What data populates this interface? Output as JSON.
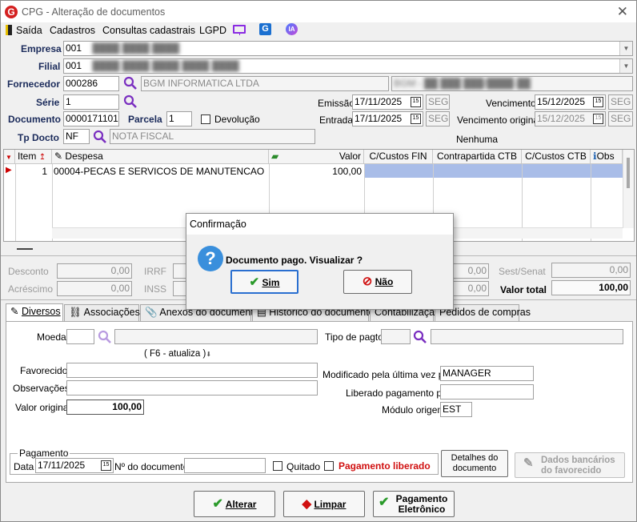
{
  "window": {
    "title": "CPG - Alteração de documentos"
  },
  "menu": {
    "items": [
      "Saída",
      "Cadastros",
      "Consultas cadastrais",
      "LGPD"
    ],
    "ia_label": "IA"
  },
  "header": {
    "empresa_label": "Empresa",
    "empresa_code": "001",
    "empresa_name": "████ ████ ████",
    "filial_label": "Filial",
    "filial_code": "001",
    "filial_name": "████ ████ ████ ████ ████",
    "fornecedor_label": "Fornecedor",
    "fornecedor_code": "000286",
    "fornecedor_name": "BGM INFORMATICA LTDA",
    "fornecedor_doc": "BGM - ██ ███ ███/████-██",
    "serie_label": "Série",
    "serie_value": "1",
    "documento_label": "Documento",
    "documento_value": "0000171101",
    "parcela_label": "Parcela",
    "parcela_value": "1",
    "devolucao_label": "Devolução",
    "tpdocto_label": "Tp Docto",
    "tpdocto_value": "NF",
    "tpdocto_desc": "NOTA FISCAL",
    "emissao_label": "Emissão",
    "emissao_value": "17/11/2025",
    "emissao_day": "SEG",
    "entrada_label": "Entrada",
    "entrada_value": "17/11/2025",
    "entrada_day": "SEG",
    "vencimento_label": "Vencimento",
    "vencimento_value": "15/12/2025",
    "vencimento_day": "SEG",
    "venc_original_label": "Vencimento original",
    "venc_original_value": "15/12/2025",
    "venc_original_day": "SEG",
    "nenhuma_label": "Nenhuma"
  },
  "grid": {
    "columns": [
      "Item",
      "Despesa",
      "Valor",
      "C/Custos FIN",
      "Contrapartida CTB",
      "C/Custos CTB",
      "Obs"
    ],
    "rows": [
      {
        "item": "1",
        "despesa": "00004-PECAS E SERVICOS DE MANUTENCAO",
        "valor": "100,00"
      }
    ]
  },
  "totals": {
    "desconto_label": "Desconto",
    "desconto_value": "0,00",
    "acrescimo_label": "Acréscimo",
    "acrescimo_value": "0,00",
    "irrf_label": "IRRF",
    "inss_label": "INSS",
    "mid1_value": "0,00",
    "mid2_value": "0,00",
    "sestsenat_label": "Sest/Senat",
    "sestsenat_value": "0,00",
    "valortotal_label": "Valor total",
    "valortotal_value": "100,00"
  },
  "tabs": [
    "Diversos",
    "Associações",
    "Anexos do documento",
    "Histórico do documento",
    "Contabilização",
    "Pedidos de compras"
  ],
  "diversos": {
    "moeda_label": "Moeda",
    "f6_hint": "( F6 - atualiza )",
    "tipopagto_label": "Tipo de pagto",
    "favorecido_label": "Favorecido",
    "observacoes_label": "Observações",
    "valororiginal_label": "Valor original",
    "valororiginal_value": "100,00",
    "modificado_label": "Modificado pela última vez por",
    "modificado_value": "MANAGER",
    "liberado_label": "Liberado pagamento por",
    "modulo_label": "Módulo origem",
    "modulo_value": "EST"
  },
  "pagamento": {
    "group_label": "Pagamento",
    "data_label": "Data",
    "data_value": "17/11/2025",
    "ndoc_label": "Nº do documento",
    "quitado_label": "Quitado",
    "liberado_label": "Pagamento liberado",
    "liberado_color": "#d01010",
    "detalhes_button": [
      "Detalhes do",
      "documento"
    ],
    "dados_bancarios_button": [
      "Dados bancários",
      "do favorecido"
    ]
  },
  "footer": {
    "alterar": "Alterar",
    "limpar": "Limpar",
    "pagamento_eletronico": [
      "Pagamento",
      "Eletrônico"
    ]
  },
  "dialog": {
    "title": "Confirmação",
    "message": "Documento pago. Visualizar ?",
    "sim": "Sim",
    "nao": "Não"
  }
}
